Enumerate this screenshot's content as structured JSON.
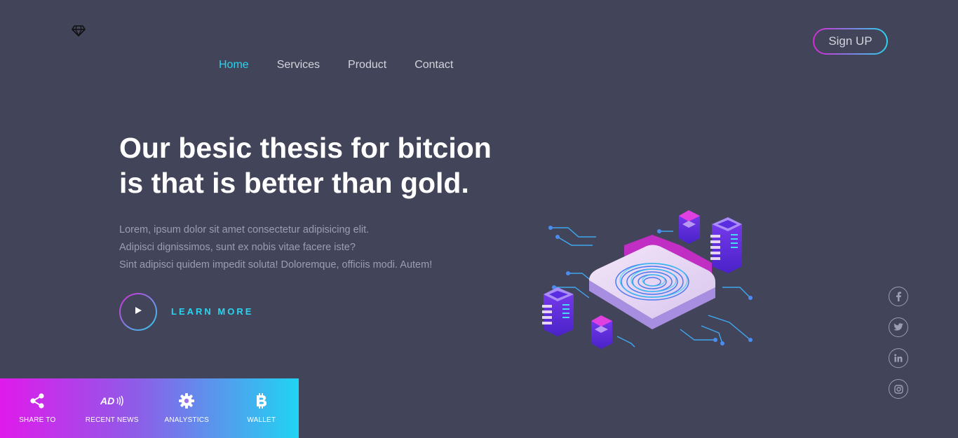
{
  "brand": {
    "logo_icon": "diamond-icon"
  },
  "nav": {
    "items": [
      {
        "label": "Home",
        "active": true
      },
      {
        "label": "Services",
        "active": false
      },
      {
        "label": "Product",
        "active": false
      },
      {
        "label": "Contact",
        "active": false
      }
    ]
  },
  "header": {
    "signup_label": "Sign UP"
  },
  "hero": {
    "title_line1": "Our besic thesis for bitcion",
    "title_line2": "is that is better than gold.",
    "text_line1": "Lorem, ipsum dolor sit amet consectetur adipisicing elit.",
    "text_line2": "Adipisci dignissimos, sunt ex nobis vitae facere iste?",
    "text_line3": "Sint adipisci quidem impedit soluta! Doloremque, officiis modi. Autem!",
    "cta_label": "LEARN MORE",
    "play_icon": "play-icon",
    "illustration": "fingerprint-security-illustration"
  },
  "social": {
    "icons": [
      "facebook-icon",
      "twitter-icon",
      "linkedin-icon",
      "instagram-icon"
    ]
  },
  "bottom_bar": {
    "items": [
      {
        "label": "SHARE TO",
        "icon": "share-icon"
      },
      {
        "label": "RECENT NEWS",
        "icon": "ad-icon"
      },
      {
        "label": "ANALYSTICS",
        "icon": "gear-icon"
      },
      {
        "label": "WALLET",
        "icon": "bitcoin-icon"
      }
    ]
  },
  "colors": {
    "background": "#424459",
    "accent_cyan": "#2ad4f0",
    "accent_magenta": "#d62ad6",
    "nav_text": "#d4d4dc",
    "body_text": "#9c9db0"
  }
}
